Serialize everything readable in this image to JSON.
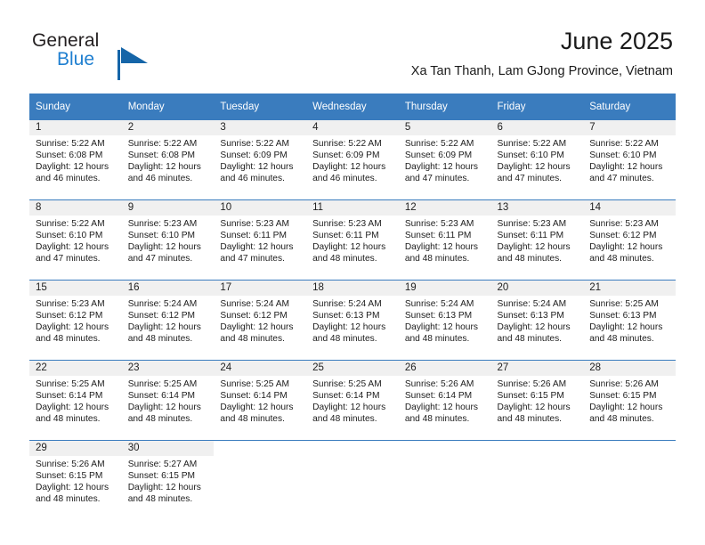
{
  "brand": {
    "word_general": "General",
    "word_blue": "Blue",
    "triangle_color": "#1565a8",
    "blue_text_color": "#1f7fd0"
  },
  "header": {
    "title": "June 2025",
    "subtitle": "Xa Tan Thanh, Lam GJong Province, Vietnam",
    "header_bg_color": "#3a7cbe",
    "daynum_band_color": "#f0f0f0"
  },
  "calendar": {
    "weekday_headers": [
      "Sunday",
      "Monday",
      "Tuesday",
      "Wednesday",
      "Thursday",
      "Friday",
      "Saturday"
    ],
    "weeks": [
      [
        {
          "day": "1",
          "sunrise": "Sunrise: 5:22 AM",
          "sunset": "Sunset: 6:08 PM",
          "daylight_line1": "Daylight: 12 hours",
          "daylight_line2": "and 46 minutes."
        },
        {
          "day": "2",
          "sunrise": "Sunrise: 5:22 AM",
          "sunset": "Sunset: 6:08 PM",
          "daylight_line1": "Daylight: 12 hours",
          "daylight_line2": "and 46 minutes."
        },
        {
          "day": "3",
          "sunrise": "Sunrise: 5:22 AM",
          "sunset": "Sunset: 6:09 PM",
          "daylight_line1": "Daylight: 12 hours",
          "daylight_line2": "and 46 minutes."
        },
        {
          "day": "4",
          "sunrise": "Sunrise: 5:22 AM",
          "sunset": "Sunset: 6:09 PM",
          "daylight_line1": "Daylight: 12 hours",
          "daylight_line2": "and 46 minutes."
        },
        {
          "day": "5",
          "sunrise": "Sunrise: 5:22 AM",
          "sunset": "Sunset: 6:09 PM",
          "daylight_line1": "Daylight: 12 hours",
          "daylight_line2": "and 47 minutes."
        },
        {
          "day": "6",
          "sunrise": "Sunrise: 5:22 AM",
          "sunset": "Sunset: 6:10 PM",
          "daylight_line1": "Daylight: 12 hours",
          "daylight_line2": "and 47 minutes."
        },
        {
          "day": "7",
          "sunrise": "Sunrise: 5:22 AM",
          "sunset": "Sunset: 6:10 PM",
          "daylight_line1": "Daylight: 12 hours",
          "daylight_line2": "and 47 minutes."
        }
      ],
      [
        {
          "day": "8",
          "sunrise": "Sunrise: 5:22 AM",
          "sunset": "Sunset: 6:10 PM",
          "daylight_line1": "Daylight: 12 hours",
          "daylight_line2": "and 47 minutes."
        },
        {
          "day": "9",
          "sunrise": "Sunrise: 5:23 AM",
          "sunset": "Sunset: 6:10 PM",
          "daylight_line1": "Daylight: 12 hours",
          "daylight_line2": "and 47 minutes."
        },
        {
          "day": "10",
          "sunrise": "Sunrise: 5:23 AM",
          "sunset": "Sunset: 6:11 PM",
          "daylight_line1": "Daylight: 12 hours",
          "daylight_line2": "and 47 minutes."
        },
        {
          "day": "11",
          "sunrise": "Sunrise: 5:23 AM",
          "sunset": "Sunset: 6:11 PM",
          "daylight_line1": "Daylight: 12 hours",
          "daylight_line2": "and 48 minutes."
        },
        {
          "day": "12",
          "sunrise": "Sunrise: 5:23 AM",
          "sunset": "Sunset: 6:11 PM",
          "daylight_line1": "Daylight: 12 hours",
          "daylight_line2": "and 48 minutes."
        },
        {
          "day": "13",
          "sunrise": "Sunrise: 5:23 AM",
          "sunset": "Sunset: 6:11 PM",
          "daylight_line1": "Daylight: 12 hours",
          "daylight_line2": "and 48 minutes."
        },
        {
          "day": "14",
          "sunrise": "Sunrise: 5:23 AM",
          "sunset": "Sunset: 6:12 PM",
          "daylight_line1": "Daylight: 12 hours",
          "daylight_line2": "and 48 minutes."
        }
      ],
      [
        {
          "day": "15",
          "sunrise": "Sunrise: 5:23 AM",
          "sunset": "Sunset: 6:12 PM",
          "daylight_line1": "Daylight: 12 hours",
          "daylight_line2": "and 48 minutes."
        },
        {
          "day": "16",
          "sunrise": "Sunrise: 5:24 AM",
          "sunset": "Sunset: 6:12 PM",
          "daylight_line1": "Daylight: 12 hours",
          "daylight_line2": "and 48 minutes."
        },
        {
          "day": "17",
          "sunrise": "Sunrise: 5:24 AM",
          "sunset": "Sunset: 6:12 PM",
          "daylight_line1": "Daylight: 12 hours",
          "daylight_line2": "and 48 minutes."
        },
        {
          "day": "18",
          "sunrise": "Sunrise: 5:24 AM",
          "sunset": "Sunset: 6:13 PM",
          "daylight_line1": "Daylight: 12 hours",
          "daylight_line2": "and 48 minutes."
        },
        {
          "day": "19",
          "sunrise": "Sunrise: 5:24 AM",
          "sunset": "Sunset: 6:13 PM",
          "daylight_line1": "Daylight: 12 hours",
          "daylight_line2": "and 48 minutes."
        },
        {
          "day": "20",
          "sunrise": "Sunrise: 5:24 AM",
          "sunset": "Sunset: 6:13 PM",
          "daylight_line1": "Daylight: 12 hours",
          "daylight_line2": "and 48 minutes."
        },
        {
          "day": "21",
          "sunrise": "Sunrise: 5:25 AM",
          "sunset": "Sunset: 6:13 PM",
          "daylight_line1": "Daylight: 12 hours",
          "daylight_line2": "and 48 minutes."
        }
      ],
      [
        {
          "day": "22",
          "sunrise": "Sunrise: 5:25 AM",
          "sunset": "Sunset: 6:14 PM",
          "daylight_line1": "Daylight: 12 hours",
          "daylight_line2": "and 48 minutes."
        },
        {
          "day": "23",
          "sunrise": "Sunrise: 5:25 AM",
          "sunset": "Sunset: 6:14 PM",
          "daylight_line1": "Daylight: 12 hours",
          "daylight_line2": "and 48 minutes."
        },
        {
          "day": "24",
          "sunrise": "Sunrise: 5:25 AM",
          "sunset": "Sunset: 6:14 PM",
          "daylight_line1": "Daylight: 12 hours",
          "daylight_line2": "and 48 minutes."
        },
        {
          "day": "25",
          "sunrise": "Sunrise: 5:25 AM",
          "sunset": "Sunset: 6:14 PM",
          "daylight_line1": "Daylight: 12 hours",
          "daylight_line2": "and 48 minutes."
        },
        {
          "day": "26",
          "sunrise": "Sunrise: 5:26 AM",
          "sunset": "Sunset: 6:14 PM",
          "daylight_line1": "Daylight: 12 hours",
          "daylight_line2": "and 48 minutes."
        },
        {
          "day": "27",
          "sunrise": "Sunrise: 5:26 AM",
          "sunset": "Sunset: 6:15 PM",
          "daylight_line1": "Daylight: 12 hours",
          "daylight_line2": "and 48 minutes."
        },
        {
          "day": "28",
          "sunrise": "Sunrise: 5:26 AM",
          "sunset": "Sunset: 6:15 PM",
          "daylight_line1": "Daylight: 12 hours",
          "daylight_line2": "and 48 minutes."
        }
      ],
      [
        {
          "day": "29",
          "sunrise": "Sunrise: 5:26 AM",
          "sunset": "Sunset: 6:15 PM",
          "daylight_line1": "Daylight: 12 hours",
          "daylight_line2": "and 48 minutes."
        },
        {
          "day": "30",
          "sunrise": "Sunrise: 5:27 AM",
          "sunset": "Sunset: 6:15 PM",
          "daylight_line1": "Daylight: 12 hours",
          "daylight_line2": "and 48 minutes."
        },
        {
          "day": "",
          "sunrise": "",
          "sunset": "",
          "daylight_line1": "",
          "daylight_line2": ""
        },
        {
          "day": "",
          "sunrise": "",
          "sunset": "",
          "daylight_line1": "",
          "daylight_line2": ""
        },
        {
          "day": "",
          "sunrise": "",
          "sunset": "",
          "daylight_line1": "",
          "daylight_line2": ""
        },
        {
          "day": "",
          "sunrise": "",
          "sunset": "",
          "daylight_line1": "",
          "daylight_line2": ""
        },
        {
          "day": "",
          "sunrise": "",
          "sunset": "",
          "daylight_line1": "",
          "daylight_line2": ""
        }
      ]
    ]
  }
}
